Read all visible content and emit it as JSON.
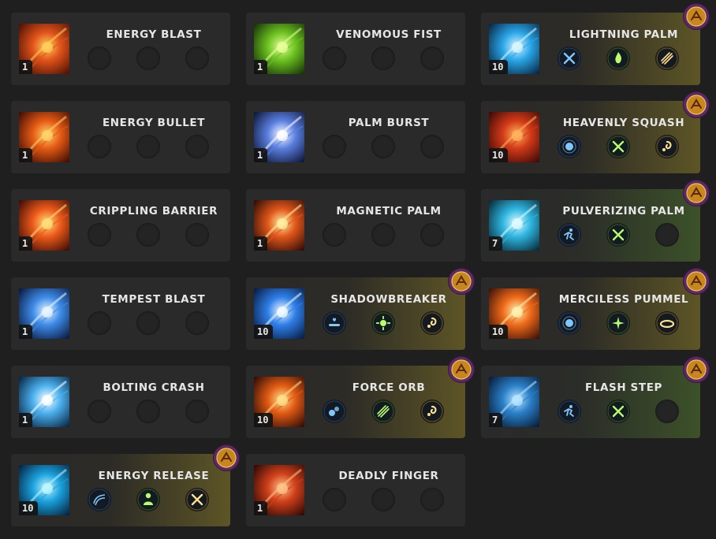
{
  "skills": [
    {
      "name": "ENERGY BLAST",
      "level": "1",
      "icon": "energy-blast-icon",
      "glow": "none",
      "badge": false,
      "tripods": []
    },
    {
      "name": "VENOMOUS FIST",
      "level": "1",
      "icon": "venomous-fist-icon",
      "glow": "none",
      "badge": false,
      "tripods": []
    },
    {
      "name": "LIGHTNING PALM",
      "level": "10",
      "icon": "lightning-palm-icon",
      "glow": "gold",
      "badge": true,
      "tripods": [
        "blue-cross-tripod-icon",
        "green-flame-tripod-icon",
        "gold-streak-tripod-icon"
      ]
    },
    {
      "name": "ENERGY BULLET",
      "level": "1",
      "icon": "energy-bullet-icon",
      "glow": "none",
      "badge": false,
      "tripods": []
    },
    {
      "name": "PALM BURST",
      "level": "1",
      "icon": "palm-burst-icon",
      "glow": "none",
      "badge": false,
      "tripods": []
    },
    {
      "name": "HEAVENLY SQUASH",
      "level": "10",
      "icon": "heavenly-squash-icon",
      "glow": "gold",
      "badge": true,
      "tripods": [
        "blue-orb-tripod-icon",
        "green-cross-tripod-icon",
        "gold-swirl-tripod-icon"
      ]
    },
    {
      "name": "CRIPPLING BARRIER",
      "level": "1",
      "icon": "crippling-barrier-icon",
      "glow": "none",
      "badge": false,
      "tripods": []
    },
    {
      "name": "MAGNETIC PALM",
      "level": "1",
      "icon": "magnetic-palm-icon",
      "glow": "none",
      "badge": false,
      "tripods": []
    },
    {
      "name": "PULVERIZING PALM",
      "level": "7",
      "icon": "pulverizing-palm-icon",
      "glow": "green",
      "badge": true,
      "tripods": [
        "blue-runner-tripod-icon",
        "green-cross-tripod-icon"
      ]
    },
    {
      "name": "TEMPEST BLAST",
      "level": "1",
      "icon": "tempest-blast-icon",
      "glow": "none",
      "badge": false,
      "tripods": []
    },
    {
      "name": "SHADOWBREAKER",
      "level": "10",
      "icon": "shadowbreaker-icon",
      "glow": "gold",
      "badge": true,
      "tripods": [
        "blue-gauge-tripod-icon",
        "green-burst-tripod-icon",
        "gold-swirl-tripod-icon"
      ]
    },
    {
      "name": "MERCILESS PUMMEL",
      "level": "10",
      "icon": "merciless-pummel-icon",
      "glow": "gold",
      "badge": true,
      "tripods": [
        "blue-orb-tripod-icon",
        "green-spark-tripod-icon",
        "gold-ring-tripod-icon"
      ]
    },
    {
      "name": "BOLTING CRASH",
      "level": "1",
      "icon": "bolting-crash-icon",
      "glow": "none",
      "badge": false,
      "tripods": []
    },
    {
      "name": "FORCE ORB",
      "level": "10",
      "icon": "force-orb-icon",
      "glow": "gold",
      "badge": true,
      "tripods": [
        "blue-bubbles-tripod-icon",
        "green-streak-tripod-icon",
        "gold-swirl-tripod-icon"
      ]
    },
    {
      "name": "FLASH STEP",
      "level": "7",
      "icon": "flash-step-icon",
      "glow": "green",
      "badge": true,
      "tripods": [
        "blue-runner-tripod-icon",
        "green-cross-tripod-icon"
      ]
    },
    {
      "name": "ENERGY RELEASE",
      "level": "10",
      "icon": "energy-release-icon",
      "glow": "gold",
      "badge": true,
      "tripods": [
        "blue-wave-tripod-icon",
        "green-figure-tripod-icon",
        "gold-cross-tripod-icon"
      ]
    },
    {
      "name": "DEADLY FINGER",
      "level": "1",
      "icon": "deadly-finger-icon",
      "glow": "none",
      "badge": false,
      "tripods": []
    }
  ]
}
